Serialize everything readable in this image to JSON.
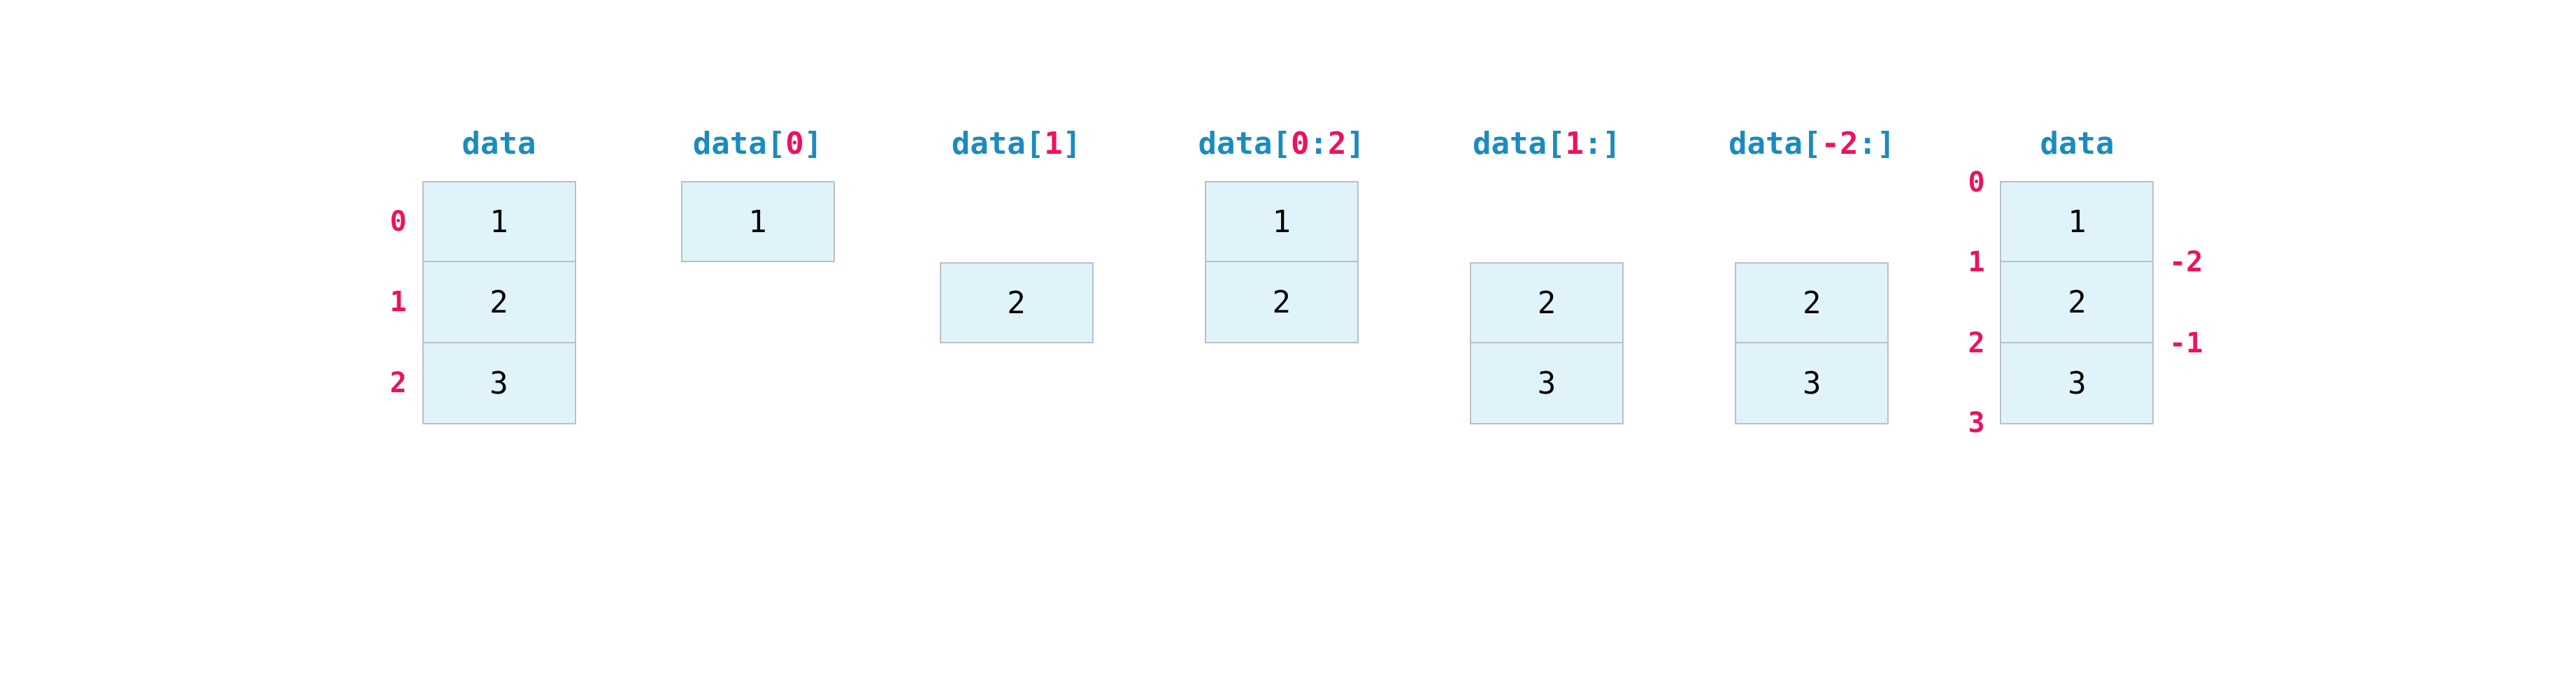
{
  "kw": "data",
  "panels": [
    {
      "title_parts": [
        "data"
      ],
      "slots": [
        {
          "filled": true,
          "val": "1",
          "idx_left": "0"
        },
        {
          "filled": true,
          "val": "2",
          "idx_left": "1"
        },
        {
          "filled": true,
          "val": "3",
          "idx_left": "2"
        }
      ]
    },
    {
      "title_parts": [
        "data",
        "[",
        "0",
        "]"
      ],
      "slots": [
        {
          "filled": true,
          "val": "1"
        },
        {
          "filled": false
        },
        {
          "filled": false
        }
      ]
    },
    {
      "title_parts": [
        "data",
        "[",
        "1",
        "]"
      ],
      "slots": [
        {
          "filled": false
        },
        {
          "filled": true,
          "val": "2"
        },
        {
          "filled": false
        }
      ]
    },
    {
      "title_parts": [
        "data",
        "[",
        "0",
        ":",
        "2",
        "]"
      ],
      "slots": [
        {
          "filled": true,
          "val": "1"
        },
        {
          "filled": true,
          "val": "2"
        },
        {
          "filled": false
        }
      ]
    },
    {
      "title_parts": [
        "data",
        "[",
        "1",
        ":",
        "]"
      ],
      "slots": [
        {
          "filled": false
        },
        {
          "filled": true,
          "val": "2"
        },
        {
          "filled": true,
          "val": "3"
        }
      ]
    },
    {
      "title_parts": [
        "data",
        "[",
        "-2",
        ":",
        "]"
      ],
      "slots": [
        {
          "filled": false
        },
        {
          "filled": true,
          "val": "2"
        },
        {
          "filled": true,
          "val": "3"
        }
      ]
    },
    {
      "title_parts": [
        "data"
      ],
      "edge_ticks": true,
      "slots": [
        {
          "filled": true,
          "val": "1",
          "tick_left": "0"
        },
        {
          "filled": true,
          "val": "2",
          "tick_left": "1",
          "tick_right": "-2"
        },
        {
          "filled": true,
          "val": "3",
          "tick_left": "2",
          "tick_right": "-1",
          "tick_left_bottom": "3"
        }
      ]
    }
  ]
}
